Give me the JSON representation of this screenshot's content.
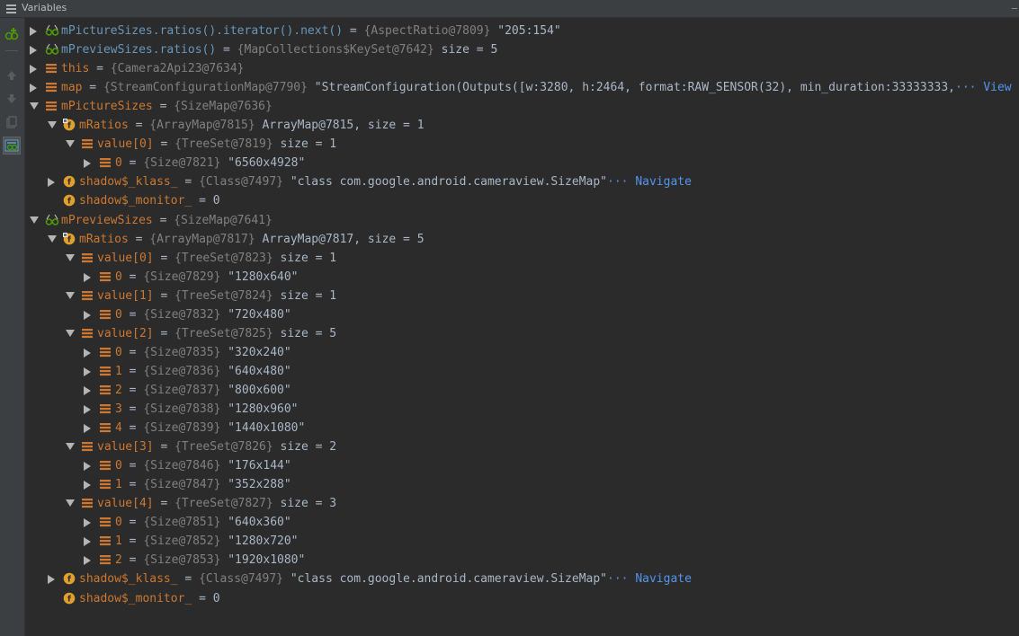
{
  "window": {
    "title": "Variables"
  },
  "colors": {
    "background": "#2b2b2b",
    "panel": "#3c3f41",
    "field_icon": "#e0a02b",
    "array_icon": "#cc7832",
    "watch_icon": "#4e9a06",
    "link": "#5394ec"
  },
  "sidebar": {
    "items": [
      {
        "name": "add-watch-icon",
        "state": "normal"
      },
      {
        "name": "remove-watch-icon",
        "state": "disabled"
      },
      {
        "name": "move-up-icon",
        "state": "disabled"
      },
      {
        "name": "move-down-icon",
        "state": "disabled"
      },
      {
        "name": "copy-icon",
        "state": "disabled"
      },
      {
        "name": "show-watches-icon",
        "state": "active"
      }
    ]
  },
  "rows": [
    {
      "depth": 0,
      "expanded": false,
      "icon": "watch",
      "name": "mPictureSizes.ratios().iterator().next()",
      "name_style": "w",
      "type": "{AspectRatio@7809}",
      "value": "\"205:154\""
    },
    {
      "depth": 0,
      "expanded": false,
      "icon": "watch",
      "name": "mPreviewSizes.ratios()",
      "name_style": "w",
      "type": "{MapCollections$KeySet@7642}",
      "value": " size = 5"
    },
    {
      "depth": 0,
      "expanded": false,
      "icon": "array",
      "name": "this",
      "name_style": "p",
      "type": "{Camera2Api23@7634}",
      "value": ""
    },
    {
      "depth": 0,
      "expanded": false,
      "icon": "array",
      "name": "map",
      "name_style": "p",
      "type": "{StreamConfigurationMap@7790}",
      "value": "\"StreamConfiguration(Outputs([w:3280, h:2464, format:RAW_SENSOR(32), min_duration:33333333,",
      "more": "··· View"
    },
    {
      "depth": 0,
      "expanded": true,
      "icon": "array",
      "name": "mPictureSizes",
      "name_style": "p",
      "type": "{SizeMap@7636}",
      "value": ""
    },
    {
      "depth": 1,
      "expanded": true,
      "icon": "field-lock",
      "name": "mRatios",
      "name_style": "p",
      "type": "{ArrayMap@7815}",
      "value": "ArrayMap@7815, size = 1"
    },
    {
      "depth": 2,
      "expanded": true,
      "icon": "array",
      "name": "value[0]",
      "name_style": "p",
      "type": "{TreeSet@7819}",
      "value": " size = 1"
    },
    {
      "depth": 3,
      "expanded": false,
      "icon": "array",
      "name": "0",
      "name_style": "p",
      "type": "{Size@7821}",
      "value": "\"6560x4928\""
    },
    {
      "depth": 1,
      "expanded": false,
      "icon": "field",
      "name": "shadow$_klass_",
      "name_style": "p",
      "type": "{Class@7497}",
      "value": "\"class com.google.android.cameraview.SizeMap\"",
      "more": "··· Navigate"
    },
    {
      "depth": 1,
      "expanded": null,
      "icon": "field",
      "name": "shadow$_monitor_",
      "name_style": "p",
      "type": "",
      "value": "= 0"
    },
    {
      "depth": 0,
      "expanded": true,
      "icon": "watch",
      "name": "mPreviewSizes",
      "name_style": "p",
      "type": "{SizeMap@7641}",
      "value": ""
    },
    {
      "depth": 1,
      "expanded": true,
      "icon": "field-lock",
      "name": "mRatios",
      "name_style": "p",
      "type": "{ArrayMap@7817}",
      "value": "ArrayMap@7817, size = 5"
    },
    {
      "depth": 2,
      "expanded": true,
      "icon": "array",
      "name": "value[0]",
      "name_style": "p",
      "type": "{TreeSet@7823}",
      "value": " size = 1"
    },
    {
      "depth": 3,
      "expanded": false,
      "icon": "array",
      "name": "0",
      "name_style": "p",
      "type": "{Size@7829}",
      "value": "\"1280x640\""
    },
    {
      "depth": 2,
      "expanded": true,
      "icon": "array",
      "name": "value[1]",
      "name_style": "p",
      "type": "{TreeSet@7824}",
      "value": " size = 1"
    },
    {
      "depth": 3,
      "expanded": false,
      "icon": "array",
      "name": "0",
      "name_style": "p",
      "type": "{Size@7832}",
      "value": "\"720x480\""
    },
    {
      "depth": 2,
      "expanded": true,
      "icon": "array",
      "name": "value[2]",
      "name_style": "p",
      "type": "{TreeSet@7825}",
      "value": " size = 5"
    },
    {
      "depth": 3,
      "expanded": false,
      "icon": "array",
      "name": "0",
      "name_style": "p",
      "type": "{Size@7835}",
      "value": "\"320x240\""
    },
    {
      "depth": 3,
      "expanded": false,
      "icon": "array",
      "name": "1",
      "name_style": "p",
      "type": "{Size@7836}",
      "value": "\"640x480\""
    },
    {
      "depth": 3,
      "expanded": false,
      "icon": "array",
      "name": "2",
      "name_style": "p",
      "type": "{Size@7837}",
      "value": "\"800x600\""
    },
    {
      "depth": 3,
      "expanded": false,
      "icon": "array",
      "name": "3",
      "name_style": "p",
      "type": "{Size@7838}",
      "value": "\"1280x960\""
    },
    {
      "depth": 3,
      "expanded": false,
      "icon": "array",
      "name": "4",
      "name_style": "p",
      "type": "{Size@7839}",
      "value": "\"1440x1080\""
    },
    {
      "depth": 2,
      "expanded": true,
      "icon": "array",
      "name": "value[3]",
      "name_style": "p",
      "type": "{TreeSet@7826}",
      "value": " size = 2"
    },
    {
      "depth": 3,
      "expanded": false,
      "icon": "array",
      "name": "0",
      "name_style": "p",
      "type": "{Size@7846}",
      "value": "\"176x144\""
    },
    {
      "depth": 3,
      "expanded": false,
      "icon": "array",
      "name": "1",
      "name_style": "p",
      "type": "{Size@7847}",
      "value": "\"352x288\""
    },
    {
      "depth": 2,
      "expanded": true,
      "icon": "array",
      "name": "value[4]",
      "name_style": "p",
      "type": "{TreeSet@7827}",
      "value": " size = 3"
    },
    {
      "depth": 3,
      "expanded": false,
      "icon": "array",
      "name": "0",
      "name_style": "p",
      "type": "{Size@7851}",
      "value": "\"640x360\""
    },
    {
      "depth": 3,
      "expanded": false,
      "icon": "array",
      "name": "1",
      "name_style": "p",
      "type": "{Size@7852}",
      "value": "\"1280x720\""
    },
    {
      "depth": 3,
      "expanded": false,
      "icon": "array",
      "name": "2",
      "name_style": "p",
      "type": "{Size@7853}",
      "value": "\"1920x1080\""
    },
    {
      "depth": 1,
      "expanded": false,
      "icon": "field",
      "name": "shadow$_klass_",
      "name_style": "p",
      "type": "{Class@7497}",
      "value": "\"class com.google.android.cameraview.SizeMap\"",
      "more": "··· Navigate"
    },
    {
      "depth": 1,
      "expanded": null,
      "icon": "field",
      "name": "shadow$_monitor_",
      "name_style": "p",
      "type": "",
      "value": "= 0"
    }
  ]
}
